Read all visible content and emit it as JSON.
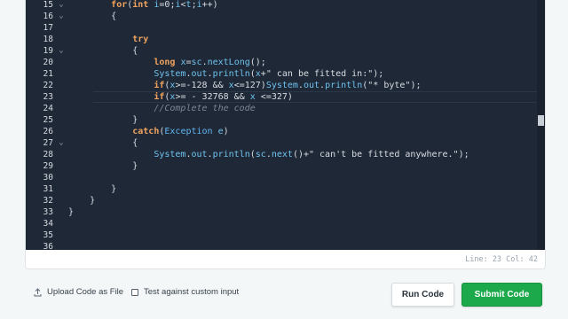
{
  "editor": {
    "lines": [
      {
        "num": "15",
        "fold": "⌄",
        "text": "        for(int i=0;i<t;i++)"
      },
      {
        "num": "16",
        "fold": "⌄",
        "text": "        {"
      },
      {
        "num": "17",
        "fold": "",
        "text": ""
      },
      {
        "num": "18",
        "fold": "",
        "text": "            try"
      },
      {
        "num": "19",
        "fold": "⌄",
        "text": "            {"
      },
      {
        "num": "20",
        "fold": "",
        "text": "                long x=sc.nextLong();"
      },
      {
        "num": "21",
        "fold": "",
        "text": "                System.out.println(x+\" can be fitted in:\");"
      },
      {
        "num": "22",
        "fold": "",
        "text": "                if(x>=-128 && x<=127)System.out.println(\"* byte\");"
      },
      {
        "num": "23",
        "fold": "",
        "text": "                if(x>= - 32768 && x <=327)"
      },
      {
        "num": "24",
        "fold": "",
        "text": "                //Complete the code"
      },
      {
        "num": "25",
        "fold": "",
        "text": "            }"
      },
      {
        "num": "26",
        "fold": "",
        "text": "            catch(Exception e)"
      },
      {
        "num": "27",
        "fold": "⌄",
        "text": "            {"
      },
      {
        "num": "28",
        "fold": "",
        "text": "                System.out.println(sc.next()+\" can't be fitted anywhere.\");"
      },
      {
        "num": "29",
        "fold": "",
        "text": "            }"
      },
      {
        "num": "30",
        "fold": "",
        "text": ""
      },
      {
        "num": "31",
        "fold": "",
        "text": "        }"
      },
      {
        "num": "32",
        "fold": "",
        "text": "    }"
      },
      {
        "num": "33",
        "fold": "",
        "text": "}"
      },
      {
        "num": "34",
        "fold": "",
        "text": ""
      },
      {
        "num": "35",
        "fold": "",
        "text": ""
      },
      {
        "num": "36",
        "fold": "",
        "text": ""
      }
    ],
    "status": "Line: 23 Col: 42"
  },
  "footer": {
    "upload_label": "Upload Code as File",
    "custom_input_label": "Test against custom input",
    "run_label": "Run Code",
    "submit_label": "Submit Code"
  },
  "colors": {
    "editor_bg": "#1e2837",
    "keyword": "#f0a35e",
    "type": "#62b5f0",
    "submit_green": "#1ba94c"
  }
}
